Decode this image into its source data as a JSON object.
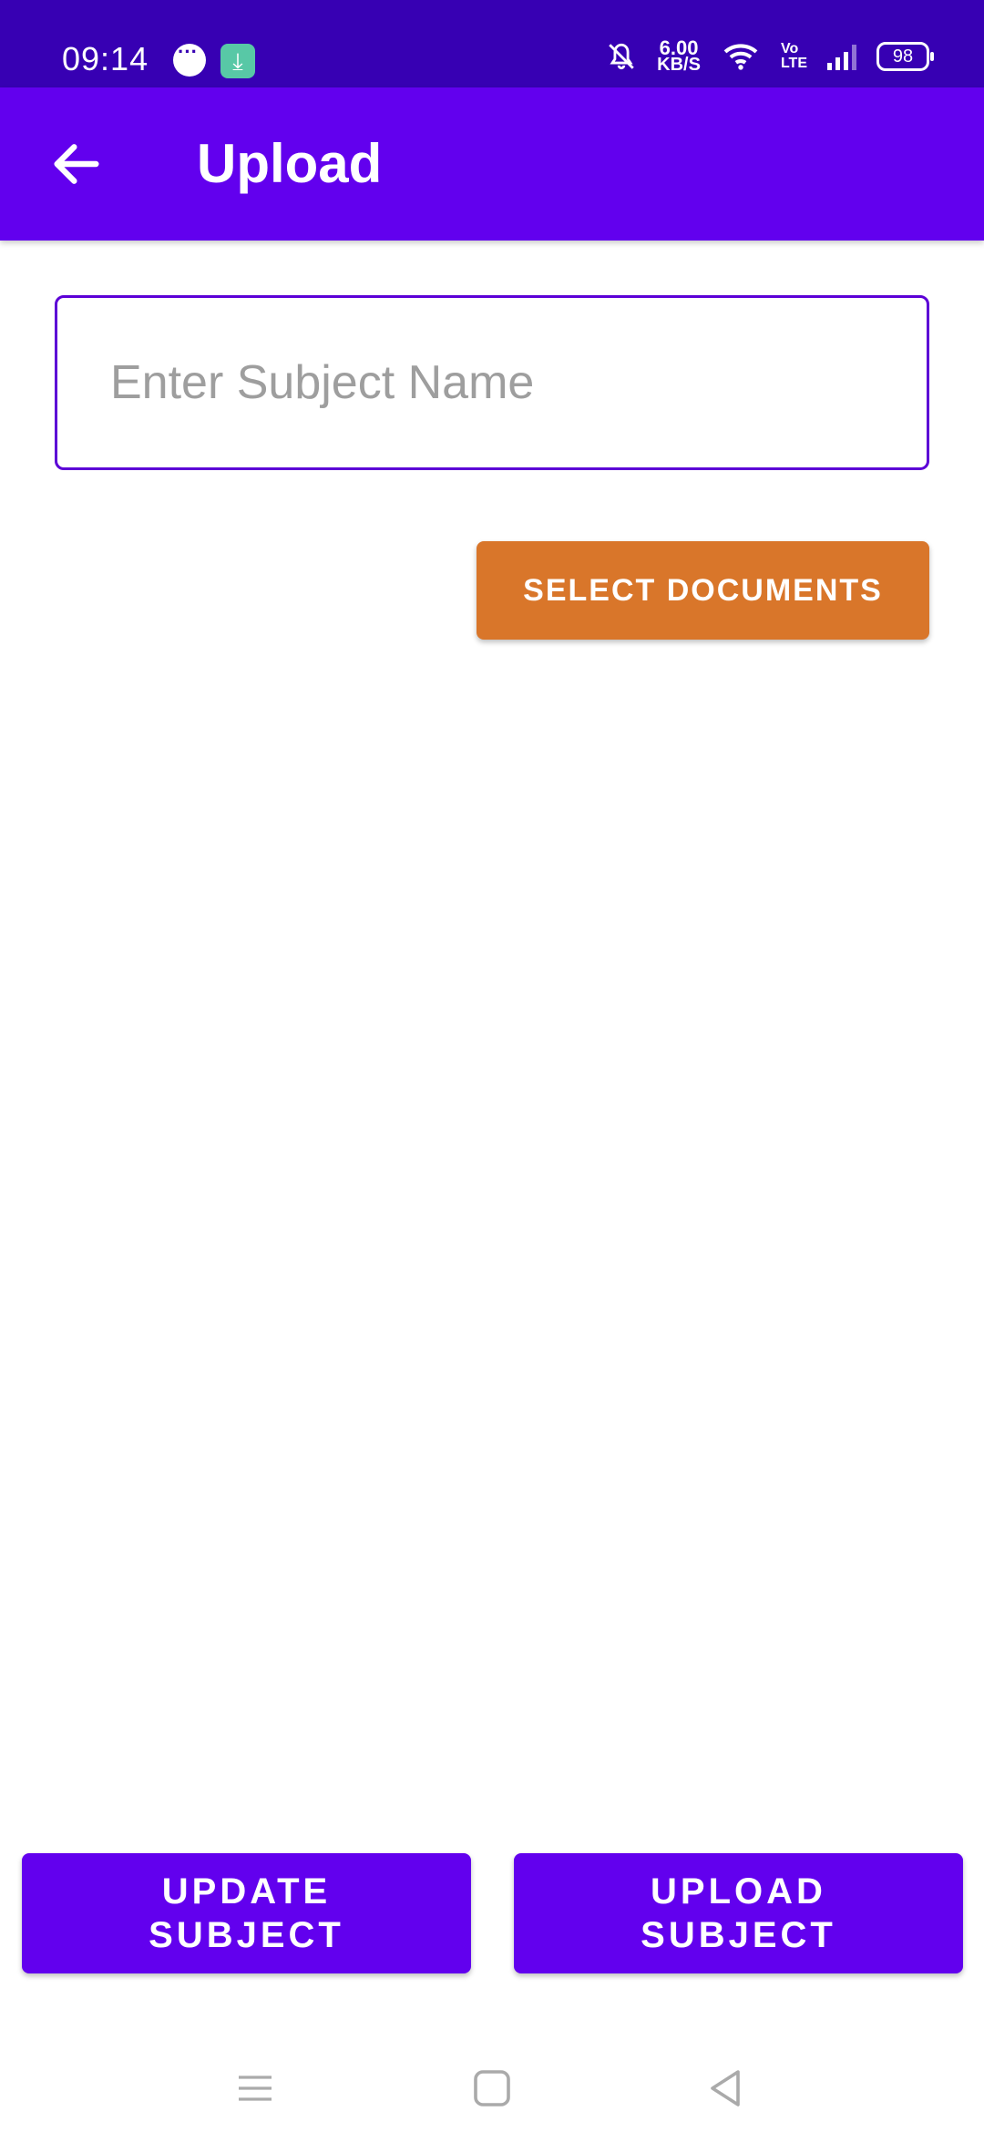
{
  "status_bar": {
    "time": "09:14",
    "speed_value": "6.00",
    "speed_unit": "KB/S",
    "network": "Vo\nLTE",
    "battery": "98"
  },
  "app_bar": {
    "title": "Upload"
  },
  "form": {
    "subject_placeholder": "Enter Subject Name",
    "subject_value": "",
    "select_documents_label": "SELECT DOCUMENTS"
  },
  "actions": {
    "update_label": "UPDATE SUBJECT",
    "upload_label": "UPLOAD SUBJECT"
  },
  "colors": {
    "status_bar": "#3700b3",
    "primary": "#6200ee",
    "accent_orange": "#d9762a"
  }
}
